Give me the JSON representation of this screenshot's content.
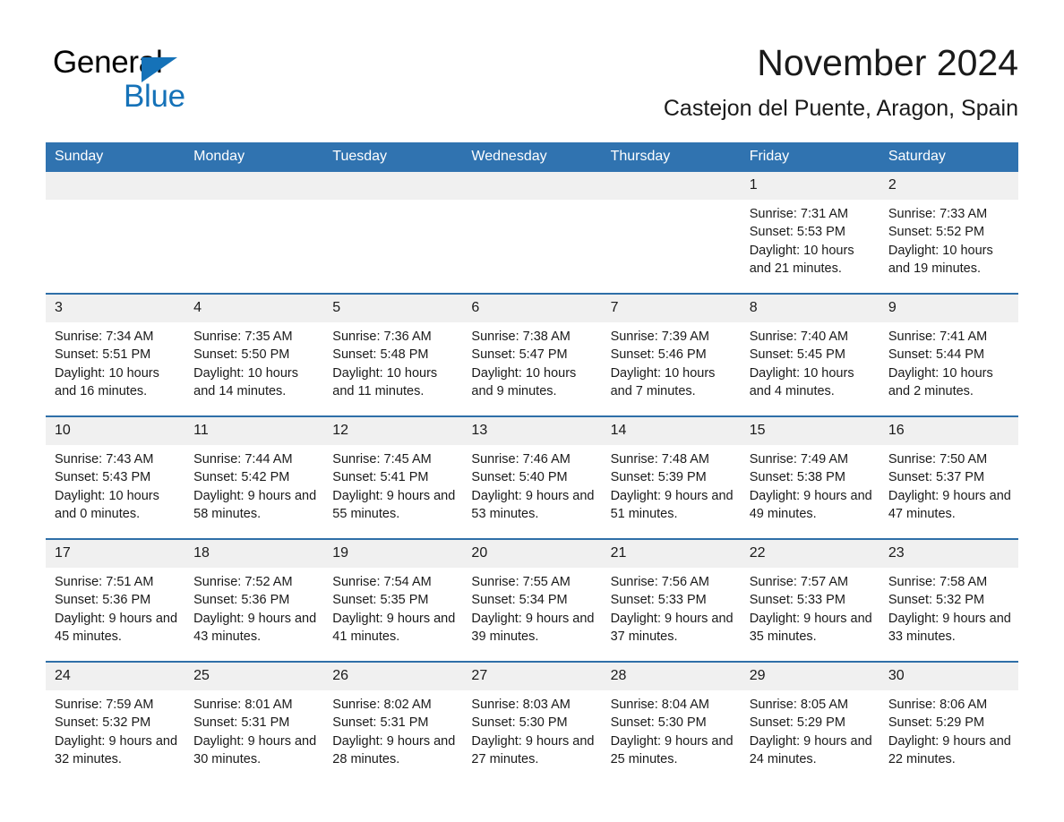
{
  "logo": {
    "line1": "General",
    "line2": "Blue",
    "triangle_icon": "blue-triangle-icon",
    "accent_color": "#1572b8"
  },
  "header": {
    "title": "November 2024",
    "subtitle": "Castejon del Puente, Aragon, Spain"
  },
  "colors": {
    "header_bar": "#3073b0",
    "row_divider": "#2f6fa8",
    "daynum_band": "#f0f0f0",
    "text": "#1a1a1a"
  },
  "weekdays": [
    {
      "label": "Sunday"
    },
    {
      "label": "Monday"
    },
    {
      "label": "Tuesday"
    },
    {
      "label": "Wednesday"
    },
    {
      "label": "Thursday"
    },
    {
      "label": "Friday"
    },
    {
      "label": "Saturday"
    }
  ],
  "weeks": [
    {
      "days": [
        {
          "day": "",
          "sunrise": "",
          "sunset": "",
          "daylight": ""
        },
        {
          "day": "",
          "sunrise": "",
          "sunset": "",
          "daylight": ""
        },
        {
          "day": "",
          "sunrise": "",
          "sunset": "",
          "daylight": ""
        },
        {
          "day": "",
          "sunrise": "",
          "sunset": "",
          "daylight": ""
        },
        {
          "day": "",
          "sunrise": "",
          "sunset": "",
          "daylight": ""
        },
        {
          "day": "1",
          "sunrise": "Sunrise: 7:31 AM",
          "sunset": "Sunset: 5:53 PM",
          "daylight": "Daylight: 10 hours and 21 minutes."
        },
        {
          "day": "2",
          "sunrise": "Sunrise: 7:33 AM",
          "sunset": "Sunset: 5:52 PM",
          "daylight": "Daylight: 10 hours and 19 minutes."
        }
      ]
    },
    {
      "days": [
        {
          "day": "3",
          "sunrise": "Sunrise: 7:34 AM",
          "sunset": "Sunset: 5:51 PM",
          "daylight": "Daylight: 10 hours and 16 minutes."
        },
        {
          "day": "4",
          "sunrise": "Sunrise: 7:35 AM",
          "sunset": "Sunset: 5:50 PM",
          "daylight": "Daylight: 10 hours and 14 minutes."
        },
        {
          "day": "5",
          "sunrise": "Sunrise: 7:36 AM",
          "sunset": "Sunset: 5:48 PM",
          "daylight": "Daylight: 10 hours and 11 minutes."
        },
        {
          "day": "6",
          "sunrise": "Sunrise: 7:38 AM",
          "sunset": "Sunset: 5:47 PM",
          "daylight": "Daylight: 10 hours and 9 minutes."
        },
        {
          "day": "7",
          "sunrise": "Sunrise: 7:39 AM",
          "sunset": "Sunset: 5:46 PM",
          "daylight": "Daylight: 10 hours and 7 minutes."
        },
        {
          "day": "8",
          "sunrise": "Sunrise: 7:40 AM",
          "sunset": "Sunset: 5:45 PM",
          "daylight": "Daylight: 10 hours and 4 minutes."
        },
        {
          "day": "9",
          "sunrise": "Sunrise: 7:41 AM",
          "sunset": "Sunset: 5:44 PM",
          "daylight": "Daylight: 10 hours and 2 minutes."
        }
      ]
    },
    {
      "days": [
        {
          "day": "10",
          "sunrise": "Sunrise: 7:43 AM",
          "sunset": "Sunset: 5:43 PM",
          "daylight": "Daylight: 10 hours and 0 minutes."
        },
        {
          "day": "11",
          "sunrise": "Sunrise: 7:44 AM",
          "sunset": "Sunset: 5:42 PM",
          "daylight": "Daylight: 9 hours and 58 minutes."
        },
        {
          "day": "12",
          "sunrise": "Sunrise: 7:45 AM",
          "sunset": "Sunset: 5:41 PM",
          "daylight": "Daylight: 9 hours and 55 minutes."
        },
        {
          "day": "13",
          "sunrise": "Sunrise: 7:46 AM",
          "sunset": "Sunset: 5:40 PM",
          "daylight": "Daylight: 9 hours and 53 minutes."
        },
        {
          "day": "14",
          "sunrise": "Sunrise: 7:48 AM",
          "sunset": "Sunset: 5:39 PM",
          "daylight": "Daylight: 9 hours and 51 minutes."
        },
        {
          "day": "15",
          "sunrise": "Sunrise: 7:49 AM",
          "sunset": "Sunset: 5:38 PM",
          "daylight": "Daylight: 9 hours and 49 minutes."
        },
        {
          "day": "16",
          "sunrise": "Sunrise: 7:50 AM",
          "sunset": "Sunset: 5:37 PM",
          "daylight": "Daylight: 9 hours and 47 minutes."
        }
      ]
    },
    {
      "days": [
        {
          "day": "17",
          "sunrise": "Sunrise: 7:51 AM",
          "sunset": "Sunset: 5:36 PM",
          "daylight": "Daylight: 9 hours and 45 minutes."
        },
        {
          "day": "18",
          "sunrise": "Sunrise: 7:52 AM",
          "sunset": "Sunset: 5:36 PM",
          "daylight": "Daylight: 9 hours and 43 minutes."
        },
        {
          "day": "19",
          "sunrise": "Sunrise: 7:54 AM",
          "sunset": "Sunset: 5:35 PM",
          "daylight": "Daylight: 9 hours and 41 minutes."
        },
        {
          "day": "20",
          "sunrise": "Sunrise: 7:55 AM",
          "sunset": "Sunset: 5:34 PM",
          "daylight": "Daylight: 9 hours and 39 minutes."
        },
        {
          "day": "21",
          "sunrise": "Sunrise: 7:56 AM",
          "sunset": "Sunset: 5:33 PM",
          "daylight": "Daylight: 9 hours and 37 minutes."
        },
        {
          "day": "22",
          "sunrise": "Sunrise: 7:57 AM",
          "sunset": "Sunset: 5:33 PM",
          "daylight": "Daylight: 9 hours and 35 minutes."
        },
        {
          "day": "23",
          "sunrise": "Sunrise: 7:58 AM",
          "sunset": "Sunset: 5:32 PM",
          "daylight": "Daylight: 9 hours and 33 minutes."
        }
      ]
    },
    {
      "days": [
        {
          "day": "24",
          "sunrise": "Sunrise: 7:59 AM",
          "sunset": "Sunset: 5:32 PM",
          "daylight": "Daylight: 9 hours and 32 minutes."
        },
        {
          "day": "25",
          "sunrise": "Sunrise: 8:01 AM",
          "sunset": "Sunset: 5:31 PM",
          "daylight": "Daylight: 9 hours and 30 minutes."
        },
        {
          "day": "26",
          "sunrise": "Sunrise: 8:02 AM",
          "sunset": "Sunset: 5:31 PM",
          "daylight": "Daylight: 9 hours and 28 minutes."
        },
        {
          "day": "27",
          "sunrise": "Sunrise: 8:03 AM",
          "sunset": "Sunset: 5:30 PM",
          "daylight": "Daylight: 9 hours and 27 minutes."
        },
        {
          "day": "28",
          "sunrise": "Sunrise: 8:04 AM",
          "sunset": "Sunset: 5:30 PM",
          "daylight": "Daylight: 9 hours and 25 minutes."
        },
        {
          "day": "29",
          "sunrise": "Sunrise: 8:05 AM",
          "sunset": "Sunset: 5:29 PM",
          "daylight": "Daylight: 9 hours and 24 minutes."
        },
        {
          "day": "30",
          "sunrise": "Sunrise: 8:06 AM",
          "sunset": "Sunset: 5:29 PM",
          "daylight": "Daylight: 9 hours and 22 minutes."
        }
      ]
    }
  ]
}
